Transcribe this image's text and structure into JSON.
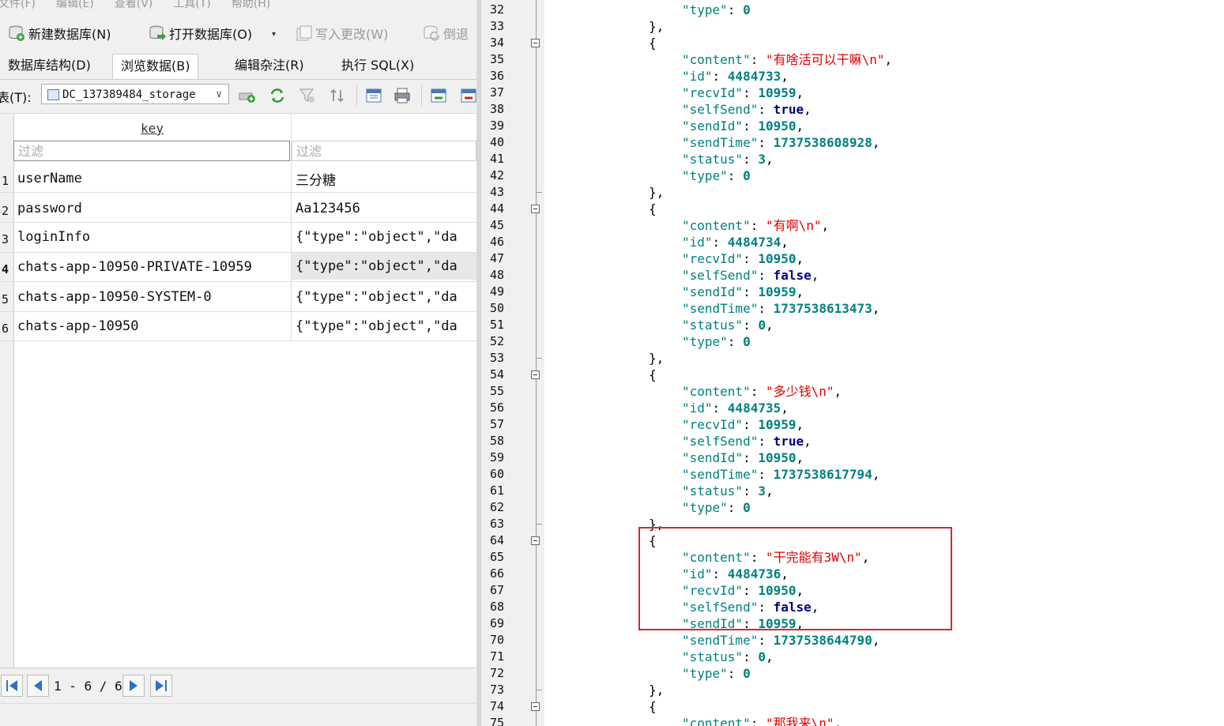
{
  "menu": [
    "文件(F)",
    "编辑(E)",
    "查看(V)",
    "工具(T)",
    "帮助(H)"
  ],
  "toolbar": {
    "new_db": "新建数据库(N)",
    "open_db": "打开数据库(O)",
    "write_changes": "写入更改(W)",
    "revert": "倒退"
  },
  "tabs": [
    "数据库结构(D)",
    "浏览数据(B)",
    "编辑杂注(R)",
    "执行 SQL(X)"
  ],
  "table_label": "表(T):",
  "table_selected": "DC_137389484_storage",
  "grid": {
    "col_key": "key",
    "filter_placeholder": "过滤",
    "rows": [
      {
        "num": "1",
        "key": "userName",
        "value": "三分糖"
      },
      {
        "num": "2",
        "key": "password",
        "value": "Aa123456"
      },
      {
        "num": "3",
        "key": "loginInfo",
        "value": "{\"type\":\"object\",\"da"
      },
      {
        "num": "4",
        "key": "chats-app-10950-PRIVATE-10959",
        "value": "{\"type\":\"object\",\"da"
      },
      {
        "num": "5",
        "key": "chats-app-10950-SYSTEM-0",
        "value": "{\"type\":\"object\",\"da"
      },
      {
        "num": "6",
        "key": "chats-app-10950",
        "value": "{\"type\":\"object\",\"da"
      }
    ]
  },
  "pager": {
    "range": "1 - 6 / 6"
  },
  "code_lines": [
    {
      "n": "32",
      "t": [
        [
          "k",
          "\"type\""
        ],
        [
          "p",
          ": "
        ],
        [
          "n",
          "0"
        ]
      ],
      "i": 2
    },
    {
      "n": "33",
      "t": [
        [
          "p",
          "},"
        ]
      ],
      "i": 1
    },
    {
      "n": "34",
      "t": [
        [
          "p",
          "{"
        ]
      ],
      "i": 1,
      "fold": true
    },
    {
      "n": "35",
      "t": [
        [
          "k",
          "\"content\""
        ],
        [
          "p",
          ": "
        ],
        [
          "s",
          "\"有啥活可以干嘛\\n\""
        ],
        [
          "p",
          ","
        ]
      ],
      "i": 2
    },
    {
      "n": "36",
      "t": [
        [
          "k",
          "\"id\""
        ],
        [
          "p",
          ": "
        ],
        [
          "n",
          "4484733"
        ],
        [
          "p",
          ","
        ]
      ],
      "i": 2
    },
    {
      "n": "37",
      "t": [
        [
          "k",
          "\"recvId\""
        ],
        [
          "p",
          ": "
        ],
        [
          "n",
          "10959"
        ],
        [
          "p",
          ","
        ]
      ],
      "i": 2
    },
    {
      "n": "38",
      "t": [
        [
          "k",
          "\"selfSend\""
        ],
        [
          "p",
          ": "
        ],
        [
          "b",
          "true"
        ],
        [
          "p",
          ","
        ]
      ],
      "i": 2
    },
    {
      "n": "39",
      "t": [
        [
          "k",
          "\"sendId\""
        ],
        [
          "p",
          ": "
        ],
        [
          "n",
          "10950"
        ],
        [
          "p",
          ","
        ]
      ],
      "i": 2
    },
    {
      "n": "40",
      "t": [
        [
          "k",
          "\"sendTime\""
        ],
        [
          "p",
          ": "
        ],
        [
          "n",
          "1737538608928"
        ],
        [
          "p",
          ","
        ]
      ],
      "i": 2
    },
    {
      "n": "41",
      "t": [
        [
          "k",
          "\"status\""
        ],
        [
          "p",
          ": "
        ],
        [
          "n",
          "3"
        ],
        [
          "p",
          ","
        ]
      ],
      "i": 2
    },
    {
      "n": "42",
      "t": [
        [
          "k",
          "\"type\""
        ],
        [
          "p",
          ": "
        ],
        [
          "n",
          "0"
        ]
      ],
      "i": 2
    },
    {
      "n": "43",
      "t": [
        [
          "p",
          "},"
        ]
      ],
      "i": 1,
      "tick": true
    },
    {
      "n": "44",
      "t": [
        [
          "p",
          "{"
        ]
      ],
      "i": 1,
      "fold": true
    },
    {
      "n": "45",
      "t": [
        [
          "k",
          "\"content\""
        ],
        [
          "p",
          ": "
        ],
        [
          "s",
          "\"有啊\\n\""
        ],
        [
          "p",
          ","
        ]
      ],
      "i": 2
    },
    {
      "n": "46",
      "t": [
        [
          "k",
          "\"id\""
        ],
        [
          "p",
          ": "
        ],
        [
          "n",
          "4484734"
        ],
        [
          "p",
          ","
        ]
      ],
      "i": 2
    },
    {
      "n": "47",
      "t": [
        [
          "k",
          "\"recvId\""
        ],
        [
          "p",
          ": "
        ],
        [
          "n",
          "10950"
        ],
        [
          "p",
          ","
        ]
      ],
      "i": 2
    },
    {
      "n": "48",
      "t": [
        [
          "k",
          "\"selfSend\""
        ],
        [
          "p",
          ": "
        ],
        [
          "b",
          "false"
        ],
        [
          "p",
          ","
        ]
      ],
      "i": 2
    },
    {
      "n": "49",
      "t": [
        [
          "k",
          "\"sendId\""
        ],
        [
          "p",
          ": "
        ],
        [
          "n",
          "10959"
        ],
        [
          "p",
          ","
        ]
      ],
      "i": 2
    },
    {
      "n": "50",
      "t": [
        [
          "k",
          "\"sendTime\""
        ],
        [
          "p",
          ": "
        ],
        [
          "n",
          "1737538613473"
        ],
        [
          "p",
          ","
        ]
      ],
      "i": 2
    },
    {
      "n": "51",
      "t": [
        [
          "k",
          "\"status\""
        ],
        [
          "p",
          ": "
        ],
        [
          "n",
          "0"
        ],
        [
          "p",
          ","
        ]
      ],
      "i": 2
    },
    {
      "n": "52",
      "t": [
        [
          "k",
          "\"type\""
        ],
        [
          "p",
          ": "
        ],
        [
          "n",
          "0"
        ]
      ],
      "i": 2
    },
    {
      "n": "53",
      "t": [
        [
          "p",
          "},"
        ]
      ],
      "i": 1,
      "tick": true
    },
    {
      "n": "54",
      "t": [
        [
          "p",
          "{"
        ]
      ],
      "i": 1,
      "fold": true
    },
    {
      "n": "55",
      "t": [
        [
          "k",
          "\"content\""
        ],
        [
          "p",
          ": "
        ],
        [
          "s",
          "\"多少钱\\n\""
        ],
        [
          "p",
          ","
        ]
      ],
      "i": 2
    },
    {
      "n": "56",
      "t": [
        [
          "k",
          "\"id\""
        ],
        [
          "p",
          ": "
        ],
        [
          "n",
          "4484735"
        ],
        [
          "p",
          ","
        ]
      ],
      "i": 2
    },
    {
      "n": "57",
      "t": [
        [
          "k",
          "\"recvId\""
        ],
        [
          "p",
          ": "
        ],
        [
          "n",
          "10959"
        ],
        [
          "p",
          ","
        ]
      ],
      "i": 2
    },
    {
      "n": "58",
      "t": [
        [
          "k",
          "\"selfSend\""
        ],
        [
          "p",
          ": "
        ],
        [
          "b",
          "true"
        ],
        [
          "p",
          ","
        ]
      ],
      "i": 2
    },
    {
      "n": "59",
      "t": [
        [
          "k",
          "\"sendId\""
        ],
        [
          "p",
          ": "
        ],
        [
          "n",
          "10950"
        ],
        [
          "p",
          ","
        ]
      ],
      "i": 2
    },
    {
      "n": "60",
      "t": [
        [
          "k",
          "\"sendTime\""
        ],
        [
          "p",
          ": "
        ],
        [
          "n",
          "1737538617794"
        ],
        [
          "p",
          ","
        ]
      ],
      "i": 2
    },
    {
      "n": "61",
      "t": [
        [
          "k",
          "\"status\""
        ],
        [
          "p",
          ": "
        ],
        [
          "n",
          "3"
        ],
        [
          "p",
          ","
        ]
      ],
      "i": 2
    },
    {
      "n": "62",
      "t": [
        [
          "k",
          "\"type\""
        ],
        [
          "p",
          ": "
        ],
        [
          "n",
          "0"
        ]
      ],
      "i": 2
    },
    {
      "n": "63",
      "t": [
        [
          "p",
          "},"
        ]
      ],
      "i": 1,
      "tick": true
    },
    {
      "n": "64",
      "t": [
        [
          "p",
          "{"
        ]
      ],
      "i": 1,
      "fold": true
    },
    {
      "n": "65",
      "t": [
        [
          "k",
          "\"content\""
        ],
        [
          "p",
          ": "
        ],
        [
          "s",
          "\"干完能有3W\\n\""
        ],
        [
          "p",
          ","
        ]
      ],
      "i": 2
    },
    {
      "n": "66",
      "t": [
        [
          "k",
          "\"id\""
        ],
        [
          "p",
          ": "
        ],
        [
          "n",
          "4484736"
        ],
        [
          "p",
          ","
        ]
      ],
      "i": 2
    },
    {
      "n": "67",
      "t": [
        [
          "k",
          "\"recvId\""
        ],
        [
          "p",
          ": "
        ],
        [
          "n",
          "10950"
        ],
        [
          "p",
          ","
        ]
      ],
      "i": 2
    },
    {
      "n": "68",
      "t": [
        [
          "k",
          "\"selfSend\""
        ],
        [
          "p",
          ": "
        ],
        [
          "b",
          "false"
        ],
        [
          "p",
          ","
        ]
      ],
      "i": 2
    },
    {
      "n": "69",
      "t": [
        [
          "k",
          "\"sendId\""
        ],
        [
          "p",
          ": "
        ],
        [
          "n",
          "10959"
        ],
        [
          "p",
          ","
        ]
      ],
      "i": 2
    },
    {
      "n": "70",
      "t": [
        [
          "k",
          "\"sendTime\""
        ],
        [
          "p",
          ": "
        ],
        [
          "n",
          "1737538644790"
        ],
        [
          "p",
          ","
        ]
      ],
      "i": 2
    },
    {
      "n": "71",
      "t": [
        [
          "k",
          "\"status\""
        ],
        [
          "p",
          ": "
        ],
        [
          "n",
          "0"
        ],
        [
          "p",
          ","
        ]
      ],
      "i": 2
    },
    {
      "n": "72",
      "t": [
        [
          "k",
          "\"type\""
        ],
        [
          "p",
          ": "
        ],
        [
          "n",
          "0"
        ]
      ],
      "i": 2
    },
    {
      "n": "73",
      "t": [
        [
          "p",
          "},"
        ]
      ],
      "i": 1,
      "tick": true
    },
    {
      "n": "74",
      "t": [
        [
          "p",
          "{"
        ]
      ],
      "i": 1,
      "fold": true
    },
    {
      "n": "75",
      "t": [
        [
          "k",
          "\"content\""
        ],
        [
          "p",
          ": "
        ],
        [
          "s",
          "\"那我来\\n\""
        ],
        [
          "p",
          ","
        ]
      ],
      "i": 2
    }
  ],
  "colors": {
    "highlight_box": "#d9262b",
    "string": "#e00000",
    "key": "#008080",
    "bool": "#000080"
  }
}
